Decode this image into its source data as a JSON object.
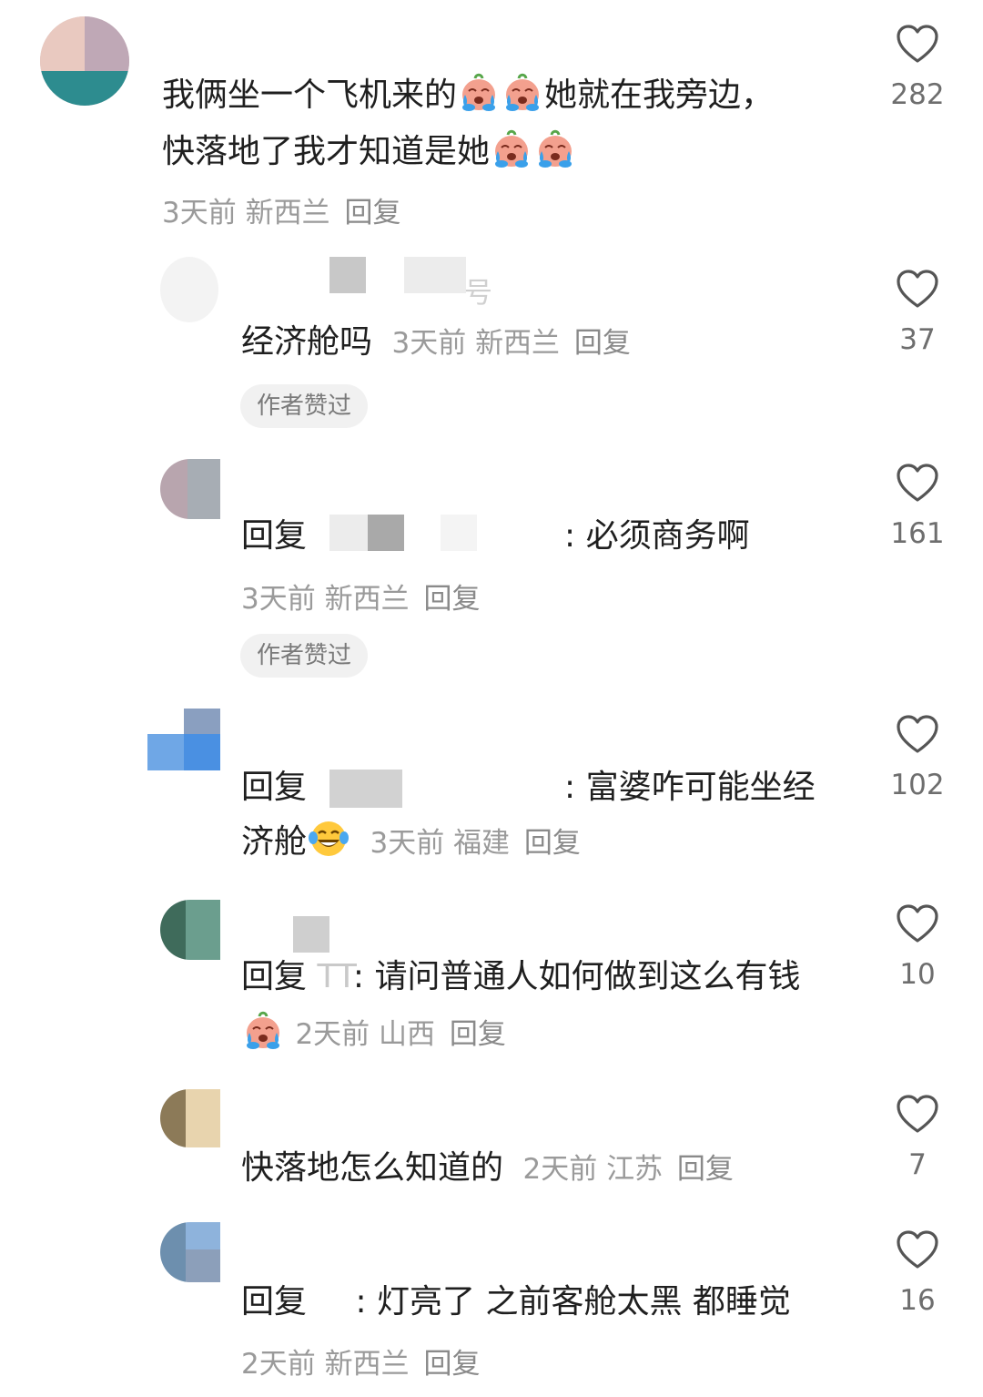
{
  "comments": [
    {
      "text_line1": "我俩坐一个飞机来的",
      "text_line1b": "她就在我旁边，",
      "text_line2": "快落地了我才知道是她",
      "time": "3天前",
      "location": "新西兰",
      "reply_label": "回复",
      "likes": "282"
    }
  ],
  "replies": [
    {
      "username_suffix": "号",
      "text": "经济舱吗",
      "time": "3天前",
      "location": "新西兰",
      "reply_label": "回复",
      "badge": "作者赞过",
      "likes": "37"
    },
    {
      "prefix": "回复",
      "text": ": 必须商务啊",
      "time": "3天前",
      "location": "新西兰",
      "reply_label": "回复",
      "badge": "作者赞过",
      "likes": "161"
    },
    {
      "prefix": "回复",
      "text_line1": ": 富婆咋可能坐经",
      "text_line2": "济舱",
      "time": "3天前",
      "location": "福建",
      "reply_label": "回复",
      "likes": "102"
    },
    {
      "prefix": "回复",
      "mention": "TT",
      "text_line1": ": 请问普通人如何做到这么有钱",
      "time": "2天前",
      "location": "山西",
      "reply_label": "回复",
      "likes": "10"
    },
    {
      "text": "快落地怎么知道的",
      "time": "2天前",
      "location": "江苏",
      "reply_label": "回复",
      "likes": "7"
    },
    {
      "prefix": "回复",
      "text": ": 灯亮了 之前客舱太黑 都睡觉",
      "time": "2天前",
      "location": "新西兰",
      "reply_label": "回复",
      "likes": "16"
    }
  ],
  "icons": {
    "like": "heart-outline-icon",
    "emoji_cry": "crying-emoji-icon",
    "emoji_laugh": "tears-of-joy-emoji-icon"
  },
  "colors": {
    "text": "#1f1f1f",
    "meta": "#9a9a9a",
    "badge_bg": "#f1f1f1"
  }
}
